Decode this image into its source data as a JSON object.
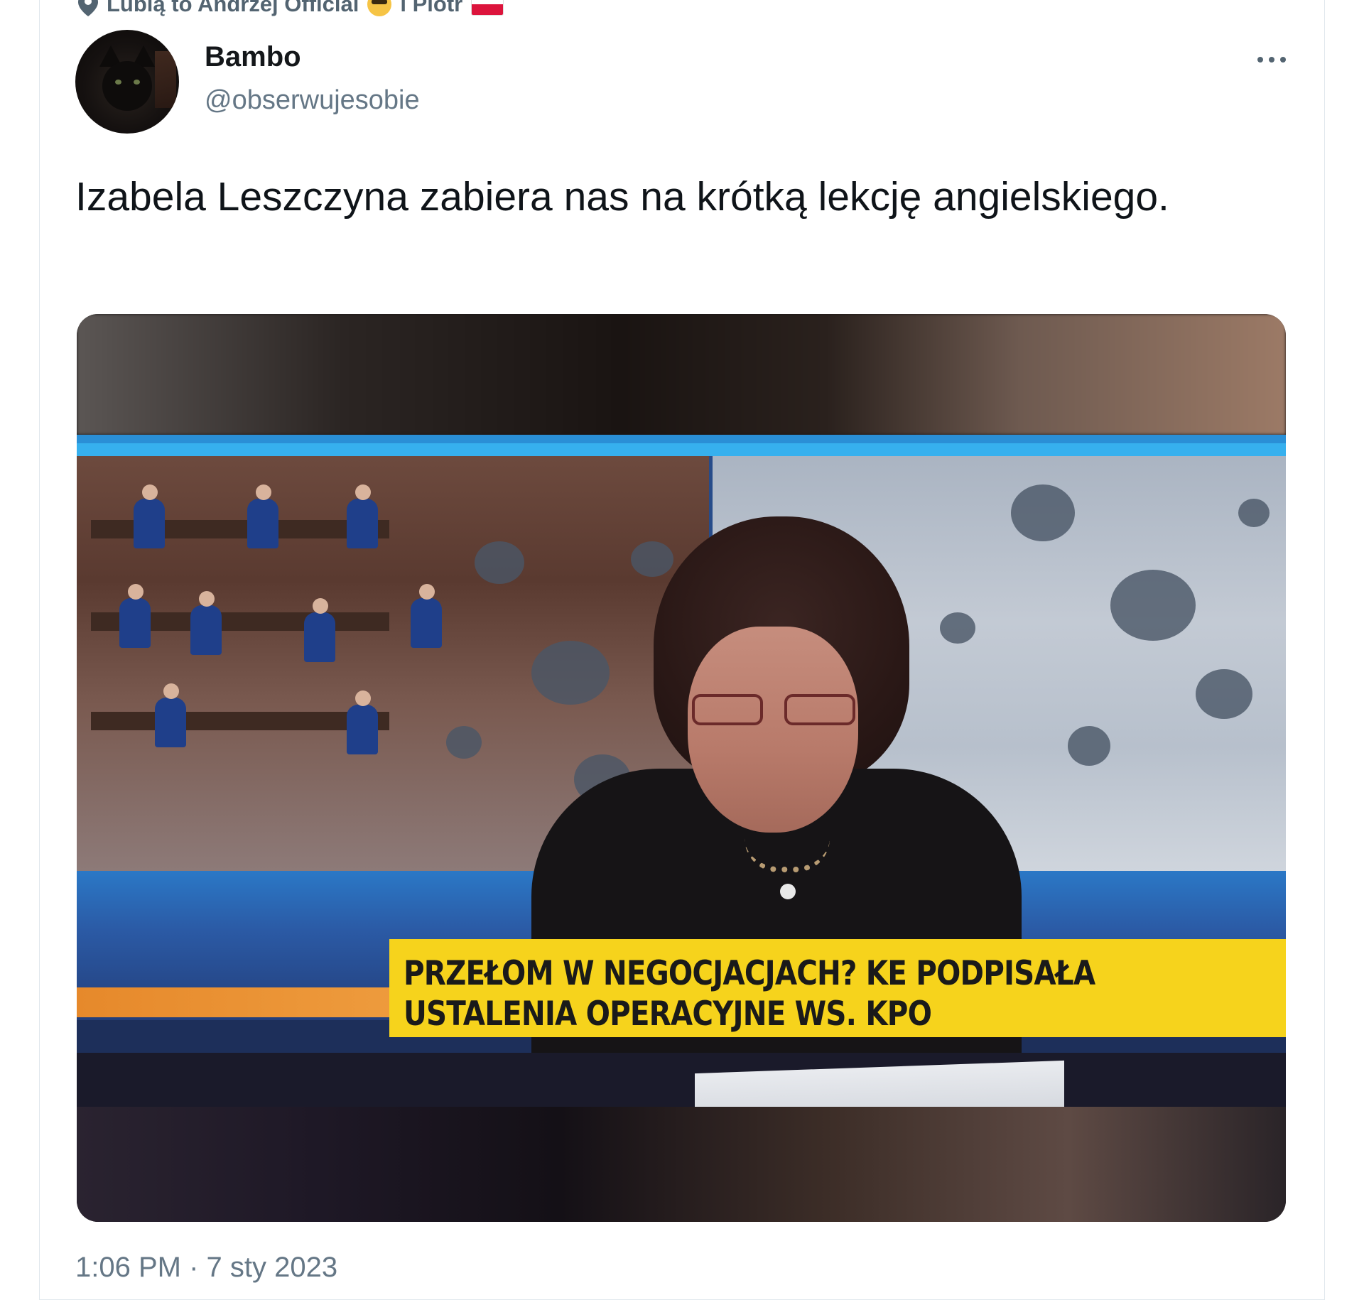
{
  "social_context": {
    "text": "Lubią to Andrzej Official",
    "suffix": "i Piotr"
  },
  "tweet": {
    "author_name": "Bambo",
    "author_handle": "@obserwujesobie",
    "text": "Izabela Leszczyna zabiera nas na krótką lekcję angielskiego.",
    "timestamp": "1:06 PM · 7 sty 2023"
  },
  "video": {
    "lower_third_line1": "PRZEŁOM W NEGOCJACJACH? KE PODPISAŁA",
    "lower_third_line2": "USTALENIA OPERACYJNE WS. KPO"
  },
  "colors": {
    "accent_yellow": "#f6d31c",
    "studio_blue": "#2b78c6",
    "muted_text": "#657786"
  },
  "icons": [
    "location-pin-icon",
    "sunglasses-emoji-icon",
    "poland-flag-icon",
    "more-options-icon"
  ]
}
